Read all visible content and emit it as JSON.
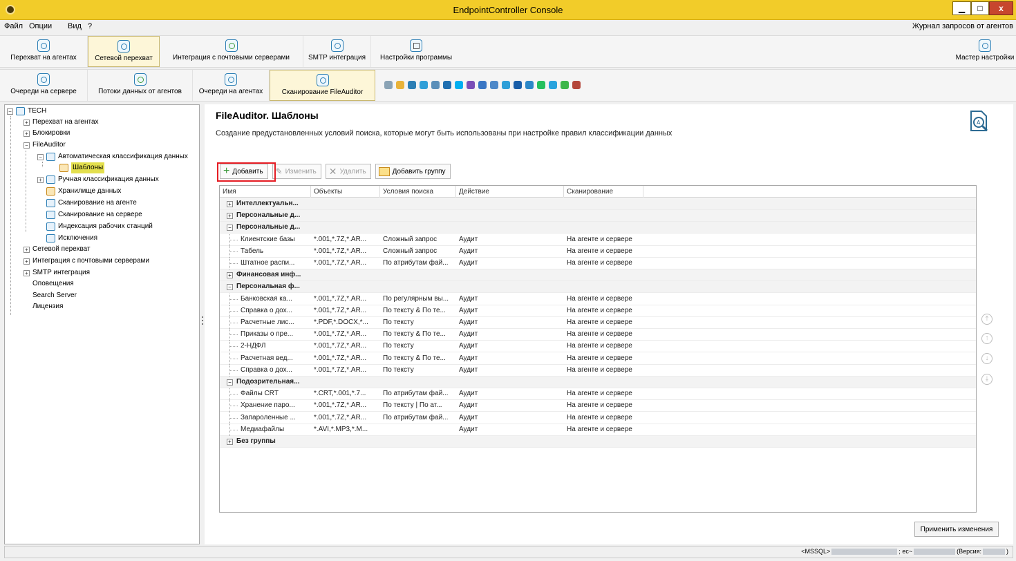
{
  "window": {
    "title": "EndpointController Console",
    "min": "▁",
    "max": "□",
    "close": "x"
  },
  "menu": {
    "items": [
      "Файл",
      "Опции",
      "Вид",
      "?"
    ],
    "right": "Журнал запросов от агентов"
  },
  "ribbon1": {
    "buttons": [
      "Перехват на агентах",
      "Сетевой перехват",
      "Интеграция с почтовыми серверами",
      "SMTP интеграция",
      "Настройки программы"
    ],
    "right": "Мастер настройки"
  },
  "ribbon2": {
    "buttons": [
      "Очереди на сервере",
      "Потоки данных от агентов",
      "Очереди на агентах",
      "Сканирование FileAuditor"
    ]
  },
  "tree": {
    "root": "TECH",
    "items": [
      "Перехват на агентах",
      "Блокировки",
      "FileAuditor",
      "Автоматическая классификация данных",
      "Шаблоны",
      "Ручная классификация данных",
      "Хранилище данных",
      "Сканирование на агенте",
      "Сканирование на сервере",
      "Индексация рабочих станций",
      "Исключения",
      "Сетевой перехват",
      "Интеграция с почтовыми серверами",
      "SMTP интеграция",
      "Оповещения",
      "Search Server",
      "Лицензия"
    ]
  },
  "main": {
    "title": "FileAuditor. Шаблоны",
    "description": "Создание предустановленных условий поиска, которые могут быть использованы при настройке правил классификации данных",
    "toolbar": {
      "add": "Добавить",
      "edit": "Изменить",
      "delete": "Удалить",
      "add_group": "Добавить группу"
    },
    "columns": [
      "Имя",
      "Объекты",
      "Условия поиска",
      "Действие",
      "Сканирование"
    ],
    "rows": [
      {
        "kind": "group",
        "name": "Интеллектуальн...",
        "exp": "+"
      },
      {
        "kind": "group",
        "name": "Персональные д...",
        "exp": "+"
      },
      {
        "kind": "group",
        "name": "Персональные д...",
        "exp": "−"
      },
      {
        "kind": "item",
        "name": "Клиентские базы",
        "objects": "*.001,*.7Z,*.AR...",
        "conditions": "Сложный запрос",
        "action": "Аудит",
        "scan": "На агенте и сервере"
      },
      {
        "kind": "item",
        "name": "Табель",
        "objects": "*.001,*.7Z,*.AR...",
        "conditions": "Сложный запрос",
        "action": "Аудит",
        "scan": "На агенте и сервере"
      },
      {
        "kind": "item",
        "name": "Штатное распи...",
        "objects": "*.001,*.7Z,*.AR...",
        "conditions": "По атрибутам фай...",
        "action": "Аудит",
        "scan": "На агенте и сервере"
      },
      {
        "kind": "group",
        "name": "Финансовая инф...",
        "exp": "+"
      },
      {
        "kind": "group",
        "name": "Персональная ф...",
        "exp": "−"
      },
      {
        "kind": "item",
        "name": "Банковская ка...",
        "objects": "*.001,*.7Z,*.AR...",
        "conditions": "По регулярным вы...",
        "action": "Аудит",
        "scan": "На агенте и сервере"
      },
      {
        "kind": "item",
        "name": "Справка о дох...",
        "objects": "*.001,*.7Z,*.AR...",
        "conditions": "По тексту & По те...",
        "action": "Аудит",
        "scan": "На агенте и сервере"
      },
      {
        "kind": "item",
        "name": "Расчетные лис...",
        "objects": "*.PDF,*.DOCX,*...",
        "conditions": "По тексту",
        "action": "Аудит",
        "scan": "На агенте и сервере"
      },
      {
        "kind": "item",
        "name": "Приказы о пре...",
        "objects": "*.001,*.7Z,*.AR...",
        "conditions": "По тексту & По те...",
        "action": "Аудит",
        "scan": "На агенте и сервере"
      },
      {
        "kind": "item",
        "name": "2-НДФЛ",
        "objects": "*.001,*.7Z,*.AR...",
        "conditions": "По тексту",
        "action": "Аудит",
        "scan": "На агенте и сервере"
      },
      {
        "kind": "item",
        "name": "Расчетная вед...",
        "objects": "*.001,*.7Z,*.AR...",
        "conditions": "По тексту & По те...",
        "action": "Аудит",
        "scan": "На агенте и сервере"
      },
      {
        "kind": "item",
        "name": "Справка о дох...",
        "objects": "*.001,*.7Z,*.AR...",
        "conditions": "По тексту",
        "action": "Аудит",
        "scan": "На агенте и сервере"
      },
      {
        "kind": "group",
        "name": "Подозрительная...",
        "exp": "−"
      },
      {
        "kind": "item",
        "name": "Файлы CRT",
        "objects": "*.CRT,*.001,*.7...",
        "conditions": "По атрибутам фай...",
        "action": "Аудит",
        "scan": "На агенте и сервере"
      },
      {
        "kind": "item",
        "name": "Хранение паро...",
        "objects": "*.001,*.7Z,*.AR...",
        "conditions": "По тексту | По ат...",
        "action": "Аудит",
        "scan": "На агенте и сервере"
      },
      {
        "kind": "item",
        "name": "Запароленные ...",
        "objects": "*.001,*.7Z,*.AR...",
        "conditions": "По атрибутам фай...",
        "action": "Аудит",
        "scan": "На агенте и сервере"
      },
      {
        "kind": "item",
        "name": "Медиафайлы",
        "objects": "*.AVI,*.MP3,*.M...",
        "conditions": "",
        "action": "Аудит",
        "scan": "На агенте и сервере"
      },
      {
        "kind": "group",
        "name": "Без группы",
        "exp": "+"
      }
    ],
    "nav": [
      "⤒",
      "↑",
      "↓",
      "⤓"
    ],
    "apply": "Применить изменения"
  },
  "status": {
    "db": "<MSSQL>",
    "sep": "; ec~",
    "version": "(Версия:",
    "close": ")"
  }
}
